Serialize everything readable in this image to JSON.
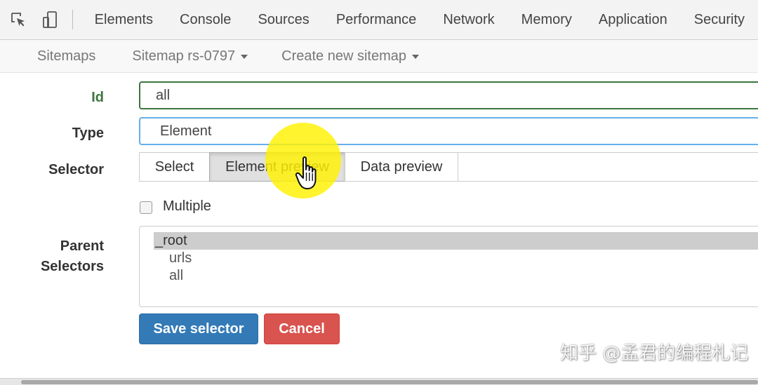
{
  "devtools": {
    "tabs": [
      "Elements",
      "Console",
      "Sources",
      "Performance",
      "Network",
      "Memory",
      "Application",
      "Security"
    ]
  },
  "subnav": {
    "sitemaps": "Sitemaps",
    "sitemap_menu": "Sitemap rs-0797",
    "create_menu": "Create new sitemap"
  },
  "form": {
    "id_label": "Id",
    "id_value": "all",
    "type_label": "Type",
    "type_value": "Element",
    "selector_label": "Selector",
    "selector_buttons": {
      "select": "Select",
      "element_preview": "Element preview",
      "data_preview": "Data preview"
    },
    "multiple_label": "Multiple",
    "parent_label_line1": "Parent",
    "parent_label_line2": "Selectors",
    "parent_options": [
      "_root",
      "urls",
      "all"
    ],
    "save_label": "Save selector",
    "cancel_label": "Cancel"
  },
  "watermark": "知乎 @孟君的编程札记",
  "colors": {
    "id_border": "#3c763d",
    "type_border": "#66afe9",
    "save_button": "#337ab7",
    "cancel_button": "#d9534f",
    "highlight": "#fff200"
  }
}
